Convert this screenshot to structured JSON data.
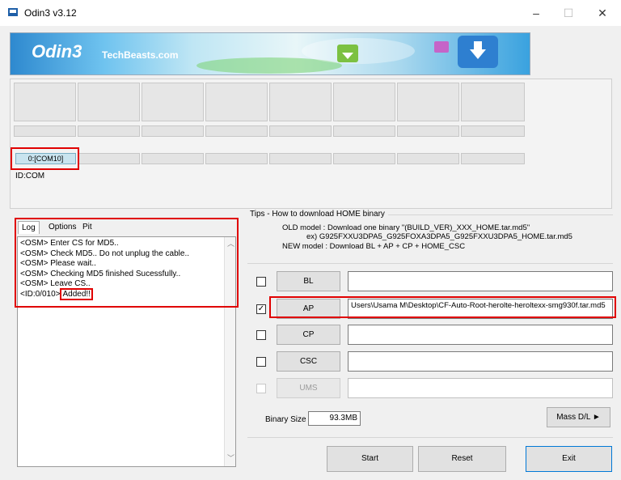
{
  "window": {
    "title": "Odin3 v3.12",
    "controls": [
      "–",
      "☐",
      "✕"
    ]
  },
  "banner": {
    "logo": "Odin3",
    "site": "TechBeasts.com"
  },
  "ports": {
    "com_label": "0:[COM10]",
    "id_text": "ID:COM"
  },
  "tabs": [
    {
      "label": "Log"
    },
    {
      "label": "Options"
    },
    {
      "label": "Pit"
    }
  ],
  "log": {
    "lines": [
      "<OSM> Enter CS for MD5..",
      "<OSM> Check MD5.. Do not unplug the cable..",
      "<OSM> Please wait..",
      "<OSM> Checking MD5 finished Sucessfully..",
      "<OSM> Leave CS.."
    ],
    "last_prefix": "<ID:0/010>",
    "last_highlight": "Added!!"
  },
  "tips": {
    "title": "Tips - How to download HOME binary",
    "old_model": "OLD model  : Download one binary    \"(BUILD_VER)_XXX_HOME.tar.md5\"",
    "example": "ex) G925FXXU3DPA5_G925FOXA3DPA5_G925FXXU3DPA5_HOME.tar.md5",
    "new_model": "NEW model : Download BL + AP + CP + HOME_CSC"
  },
  "files": [
    {
      "label": "BL",
      "checked": false,
      "path": ""
    },
    {
      "label": "AP",
      "checked": true,
      "path": "Users\\Usama M\\Desktop\\CF-Auto-Root-herolte-heroltexx-smg930f.tar.md5"
    },
    {
      "label": "CP",
      "checked": false,
      "path": ""
    },
    {
      "label": "CSC",
      "checked": false,
      "path": ""
    },
    {
      "label": "UMS",
      "checked": false,
      "path": ""
    }
  ],
  "binary_size": {
    "label": "Binary Size",
    "value": "93.3MB"
  },
  "buttons": {
    "mass": "Mass D/L ►",
    "start": "Start",
    "reset": "Reset",
    "exit": "Exit"
  }
}
